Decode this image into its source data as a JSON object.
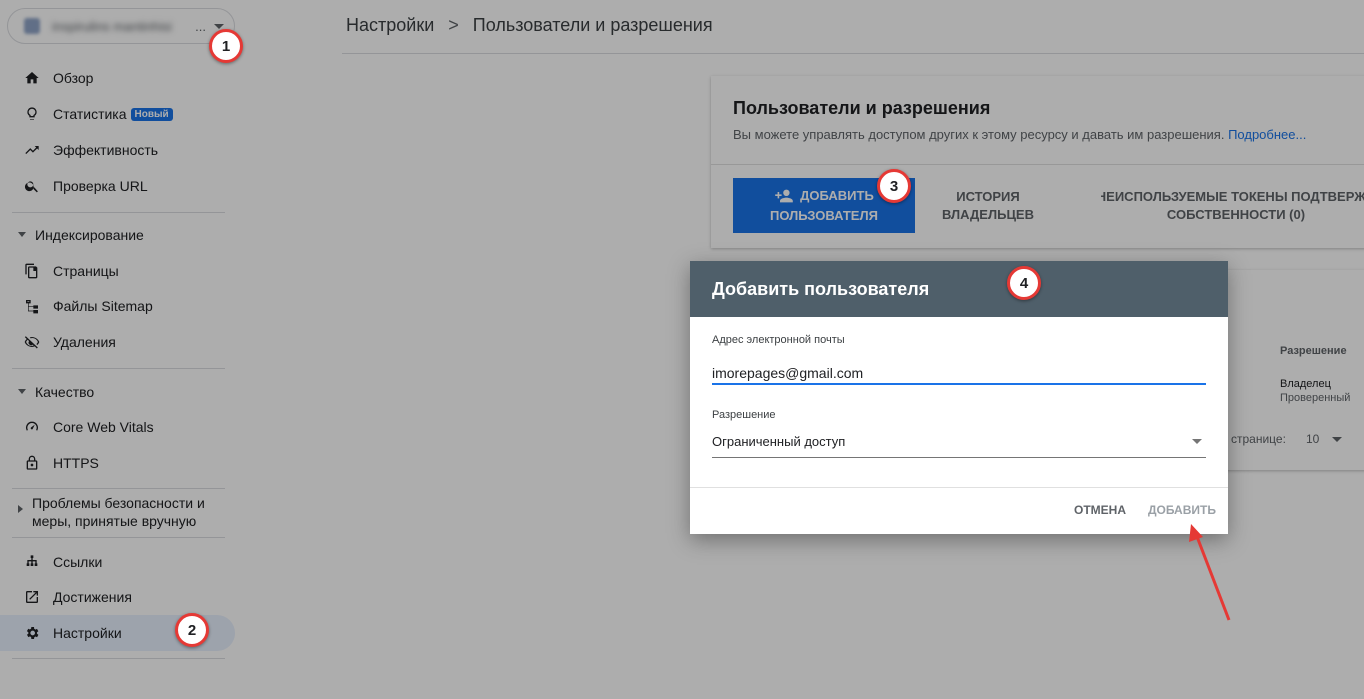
{
  "sidebar": {
    "property_name": "inspirulins mantinhisi",
    "property_ellipsis": "...",
    "items": [
      {
        "label": "Обзор"
      },
      {
        "label": "Статистика",
        "badge": "Новый"
      },
      {
        "label": "Эффективность"
      },
      {
        "label": "Проверка URL"
      },
      {
        "label": "Страницы"
      },
      {
        "label": "Файлы Sitemap"
      },
      {
        "label": "Удаления"
      },
      {
        "label": "Core Web Vitals"
      },
      {
        "label": "HTTPS"
      },
      {
        "label": "Ссылки"
      },
      {
        "label": "Достижения"
      },
      {
        "label": "Настройки"
      }
    ],
    "sections": {
      "indexing": "Индексирование",
      "quality": "Качество",
      "security_line1": "Проблемы безопасности и",
      "security_line2": "меры, принятые вручную"
    }
  },
  "breadcrumb": {
    "root": "Настройки",
    "separator": ">",
    "current": "Пользователи и разрешения"
  },
  "card": {
    "title": "Пользователи и разрешения",
    "description": "Вы можете управлять доступом других к этому ресурсу и давать им разрешения.",
    "more_link": "Подробнее...",
    "add_user_line1": "Добавить",
    "add_user_line2": "пользователя",
    "history_line1": "История",
    "history_line2": "владельцев",
    "tokens_line1": "Неиспользуемые токены подтвержд",
    "tokens_line2": "собственности (0)"
  },
  "table": {
    "col_permission": "Разрешение",
    "owner": "Владелец",
    "verified": "Проверенный",
    "per_page_label": "а странице:",
    "per_page_value": "10"
  },
  "dialog": {
    "title": "Добавить пользователя",
    "email_label": "Адрес электронной почты",
    "email_value": "imorepages@gmail.com",
    "permission_label": "Разрешение",
    "permission_value": "Ограниченный доступ",
    "cancel": "Отмена",
    "add": "Добавить"
  },
  "markers": [
    "1",
    "2",
    "3",
    "4"
  ],
  "colors": {
    "accent": "#1a73e8",
    "dialog_header": "#4f5f6a",
    "marker_border": "#e53935",
    "arrow": "#e53935"
  }
}
